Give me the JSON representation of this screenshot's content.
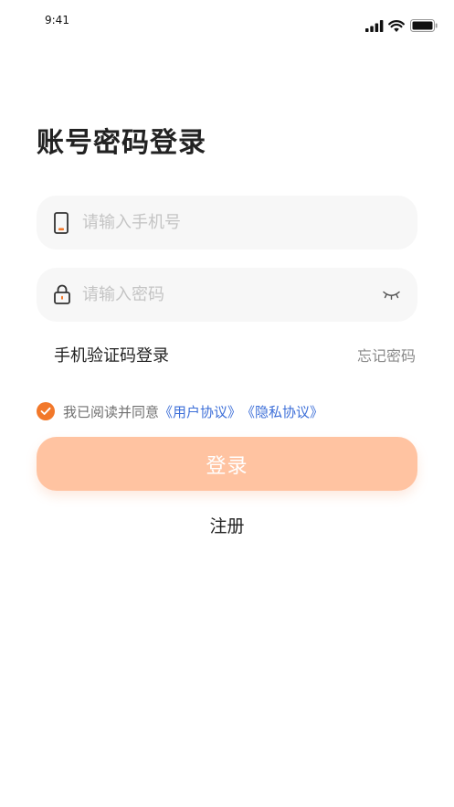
{
  "status_bar": {
    "time": "9:41",
    "icons": [
      "signal-icon",
      "wifi-icon",
      "battery-icon"
    ]
  },
  "page_title": "账号密码登录",
  "phone_field": {
    "icon": "phone-icon",
    "placeholder": "请输入手机号",
    "value": ""
  },
  "password_field": {
    "icon": "lock-icon",
    "placeholder": "请输入密码",
    "value": "",
    "toggle_icon": "eye-closed-icon"
  },
  "links": {
    "sms_login": "手机验证码登录",
    "forgot_password": "忘记密码"
  },
  "agreement": {
    "checked": true,
    "text": "我已阅读并同意",
    "user_agreement": "《用户协议》",
    "privacy_policy": "《隐私协议》"
  },
  "login_button": "登录",
  "register_link": "注册",
  "colors": {
    "accent": "#f2782a",
    "button_disabled": "#ffc3a1",
    "link_blue": "#3d6fd8",
    "field_bg": "#f7f7f7",
    "placeholder": "#c4c4c4"
  }
}
